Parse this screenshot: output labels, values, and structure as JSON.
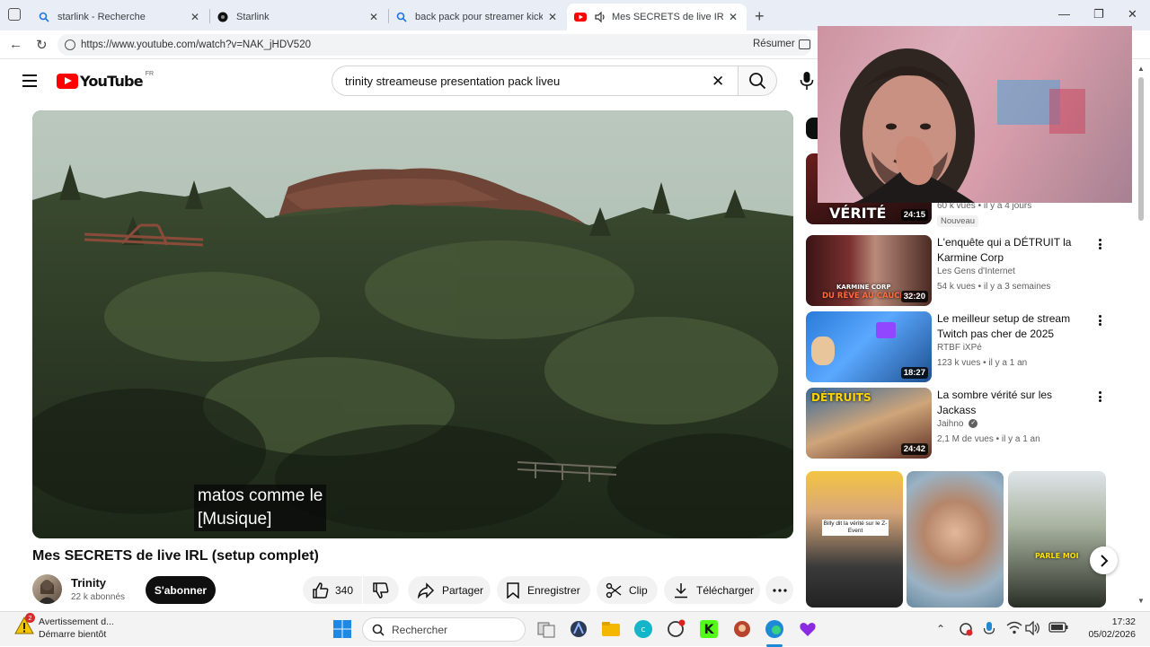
{
  "browser": {
    "tabs": [
      {
        "title": "starlink - Recherche",
        "icon": "search-icon",
        "active": false
      },
      {
        "title": "Starlink",
        "icon": "starlink-icon",
        "active": false
      },
      {
        "title": "back pack pour streamer kick twitc",
        "icon": "search-icon",
        "active": false
      },
      {
        "title": "Mes SECRETS de live IRL (setu",
        "icon": "youtube-icon",
        "active": true
      }
    ],
    "url": "https://www.youtube.com/watch?v=NAK_jHDV520",
    "resume_label": "Résumer"
  },
  "youtube": {
    "logo_text": "YouTube",
    "country_code": "FR",
    "search_query": "trinity streameuse presentation pack liveu"
  },
  "video": {
    "subtitle_lines": [
      "matos comme le",
      "[Musique]"
    ],
    "title": "Mes SECRETS de live IRL (setup complet)",
    "channel": "Trinity",
    "subscribers": "22 k abonnés",
    "subscribe_label": "S'abonner",
    "likes": "340",
    "share_label": "Partager",
    "save_label": "Enregistrer",
    "clip_label": "Clip",
    "download_label": "Télécharger"
  },
  "sidebar": {
    "partial_item": {
      "duration": "24:15",
      "thumb_text": "VÉRITÉ",
      "meta": "60 k vues • il y a 4 jours",
      "badge": "Nouveau"
    },
    "items": [
      {
        "title": "L'enquête qui a DÉTRUIT la Karmine Corp",
        "channel": "Les Gens d'Internet",
        "meta": "54 k vues • il y a 3 semaines",
        "duration": "32:20",
        "thumb_text_1": "KARMINE CORP",
        "thumb_text_2": "DU RÊVE AU CAUCHEM",
        "verified": false
      },
      {
        "title": "Le meilleur setup de stream Twitch pas cher de 2025",
        "channel": "RTBF iXPé",
        "meta": "123 k vues • il y a 1 an",
        "duration": "18:27",
        "verified": false
      },
      {
        "title": "La sombre vérité sur les Jackass",
        "channel": "Jaihno",
        "meta": "2,1 M de vues • il y a 1 an",
        "duration": "24:42",
        "thumb_text_1": "DÉTRUITS",
        "verified": true
      }
    ],
    "shorts": [
      {
        "caption": "Billy dit la vérité sur le Z-Event"
      },
      {
        "caption": ""
      },
      {
        "caption": "PARLE MOI"
      }
    ]
  },
  "taskbar": {
    "weather_title": "Avertissement d...",
    "weather_sub": "Démarre bientôt",
    "weather_badge": "2",
    "search_placeholder": "Rechercher",
    "time": "17:32",
    "date": "05/02/2026"
  },
  "colors": {
    "youtube_red": "#ff0000",
    "subscribe_bg": "#0f0f0f",
    "pill_bg": "#f2f2f2",
    "taskbar_bg": "#f3f3f3"
  }
}
